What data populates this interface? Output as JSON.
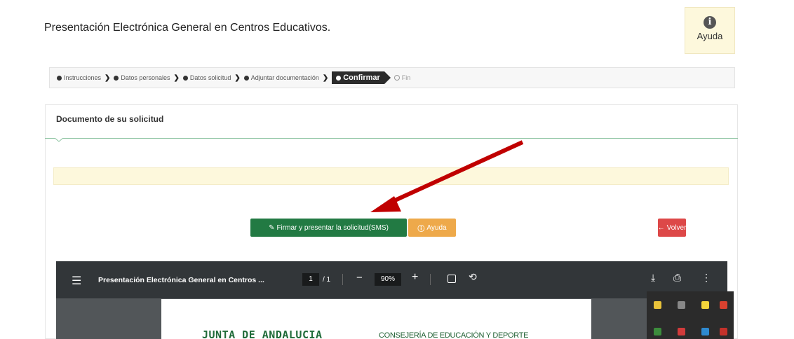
{
  "page": {
    "title": "Presentación Electrónica General en Centros Educativos.",
    "help_label": "Ayuda",
    "help_icon": "info-circle-icon"
  },
  "steps": [
    {
      "label": "Instrucciones",
      "state": "done"
    },
    {
      "label": "Datos personales",
      "state": "done"
    },
    {
      "label": "Datos solicitud",
      "state": "done"
    },
    {
      "label": "Adjuntar documentación",
      "state": "done"
    },
    {
      "label": "Confirmar",
      "state": "active"
    },
    {
      "label": "Fin",
      "state": "pending"
    }
  ],
  "panel": {
    "title": "Documento de su solicitud"
  },
  "buttons": {
    "sign": "Firmar y presentar la solicitud(SMS)",
    "help": "Ayuda",
    "back": "Volver"
  },
  "colors": {
    "sign": "#227a43",
    "help": "#eea94a",
    "back": "#dd4848",
    "annotation_arrow": "#c00000"
  },
  "viewer": {
    "title": "Presentación Electrónica General en Centros ...",
    "page_current": "1",
    "page_total": "/ 1",
    "zoom": "90%"
  },
  "document": {
    "header_left": "JUNTA DE ANDALUCIA",
    "header_right": "CONSEJERÍA DE EDUCACIÓN Y DEPORTE"
  }
}
